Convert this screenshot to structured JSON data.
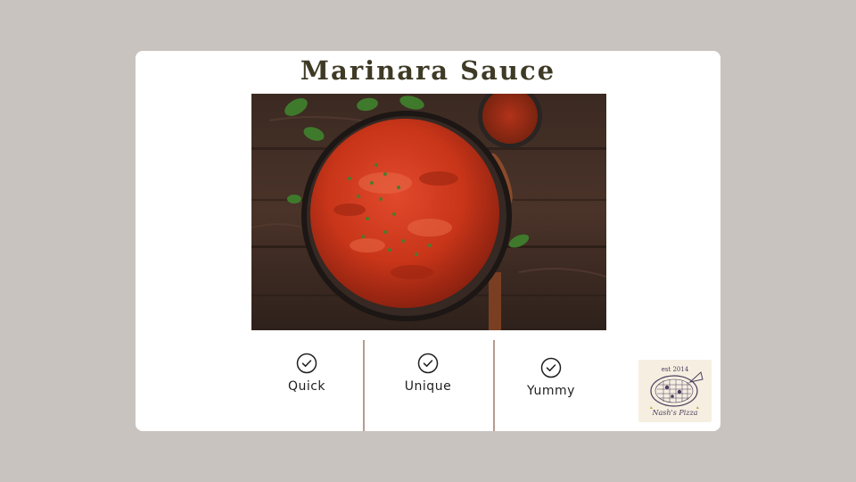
{
  "slide": {
    "title": "Marinara Sauce",
    "image": "marinara sauce in a glass bowl on a wooden table",
    "features": [
      {
        "label": "Quick",
        "icon": "check-circle-icon"
      },
      {
        "label": "Unique",
        "icon": "check-circle-icon"
      },
      {
        "label": "Yummy",
        "icon": "check-circle-icon"
      }
    ],
    "logo": {
      "est": "est 2014",
      "name": "Nash's Pizza",
      "icon": "pizza-logo-icon"
    }
  },
  "colors": {
    "background": "#c9c3bf",
    "card": "#ffffff",
    "title": "#3e3a25",
    "divider": "#b89a91"
  }
}
